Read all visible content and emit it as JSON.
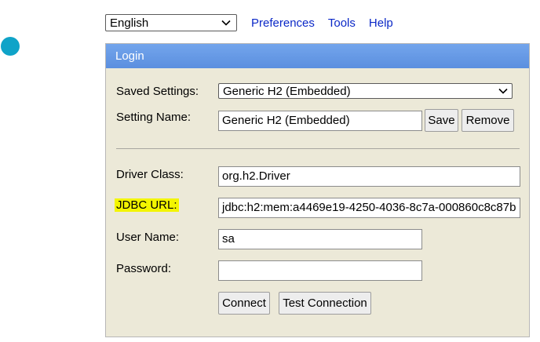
{
  "toolbar": {
    "language": "English",
    "links": [
      "Preferences",
      "Tools",
      "Help"
    ]
  },
  "login": {
    "title": "Login",
    "saved_settings_label": "Saved Settings:",
    "saved_settings_value": "Generic H2 (Embedded)",
    "setting_name_label": "Setting Name:",
    "setting_name_value": "Generic H2 (Embedded)",
    "save_label": "Save",
    "remove_label": "Remove",
    "driver_class_label": "Driver Class:",
    "driver_class_value": "org.h2.Driver",
    "jdbc_url_label": "JDBC URL:",
    "jdbc_url_value": "jdbc:h2:mem:a4469e19-4250-4036-8c7a-000860c8c87b",
    "user_name_label": "User Name:",
    "user_name_value": "sa",
    "password_label": "Password:",
    "password_value": "",
    "connect_label": "Connect",
    "test_connection_label": "Test Connection"
  },
  "colors": {
    "header": "#5b8fdf",
    "panel_bg": "#ece9d8",
    "link": "#0b28c7",
    "highlight": "#f3f500",
    "dot": "#0fa3c8"
  }
}
